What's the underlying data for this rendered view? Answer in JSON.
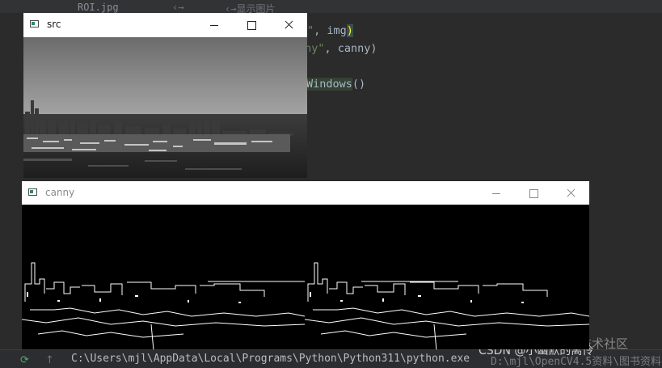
{
  "ide": {
    "tabs": [
      "ROI.jpg",
      "‹→",
      "‹→显示图片"
    ],
    "code": {
      "line1_str": "\"",
      "line1_rest": ", img",
      "line1_paren": ")",
      "line2_str": "nny\"",
      "line2_rest": ", canny)",
      "line3_word": "Windows",
      "line3_rest": "()"
    },
    "console": {
      "command": "C:\\Users\\mjl\\AppData\\Local\\Programs\\Python\\Python311\\python.exe",
      "continuation": "D:\\mjl\\OpenCV4.5资料\\图书资料"
    },
    "watermark_1": "稀土掘金技术社区",
    "watermark_2": "CSDN @小幽默的离伶"
  },
  "windows": {
    "src": {
      "title": "src"
    },
    "canny": {
      "title": "canny"
    }
  },
  "icons": {
    "window": "window-app-icon",
    "minimize": "minimize-icon",
    "maximize": "maximize-icon",
    "close": "close-icon",
    "run": "rerun-icon",
    "scroll_up": "arrow-up-icon"
  }
}
